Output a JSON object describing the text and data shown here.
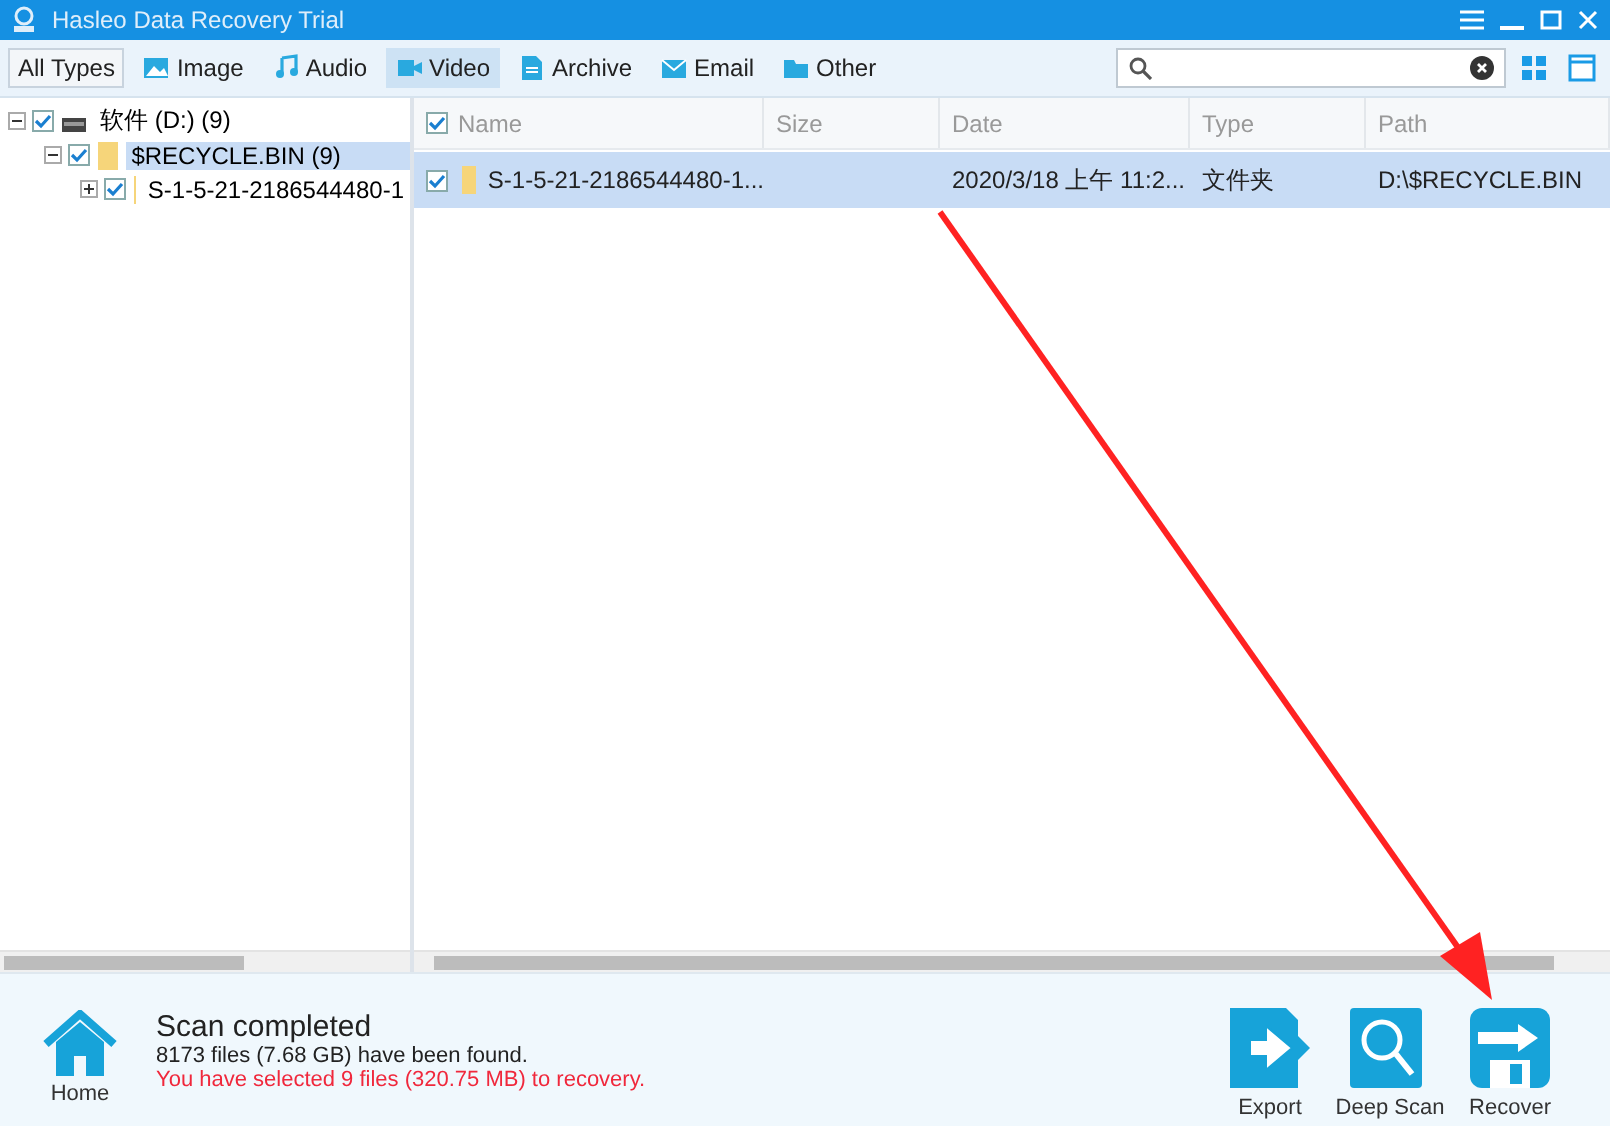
{
  "window": {
    "title": "Hasleo Data Recovery Trial"
  },
  "tabs": [
    {
      "label": "All Types",
      "kind": "all",
      "selected": false
    },
    {
      "label": "Image",
      "kind": "image",
      "selected": false
    },
    {
      "label": "Audio",
      "kind": "audio",
      "selected": false
    },
    {
      "label": "Video",
      "kind": "video",
      "selected": true
    },
    {
      "label": "Archive",
      "kind": "archive",
      "selected": false
    },
    {
      "label": "Email",
      "kind": "email",
      "selected": false
    },
    {
      "label": "Other",
      "kind": "other",
      "selected": false
    }
  ],
  "tree": [
    {
      "label": "软件 (D:) (9)",
      "kind": "drive",
      "expanded": true,
      "checked": true,
      "selected": false,
      "children": [
        {
          "label": "$RECYCLE.BIN (9)",
          "kind": "folder",
          "expanded": true,
          "checked": true,
          "selected": true,
          "children": [
            {
              "label": "S-1-5-21-2186544480-1",
              "kind": "folder",
              "expanded": false,
              "checked": true,
              "selected": false
            }
          ]
        }
      ]
    }
  ],
  "table": {
    "all_checked": true,
    "columns": [
      "Name",
      "Size",
      "Date",
      "Type",
      "Path"
    ],
    "rows": [
      {
        "checked": true,
        "selected": true,
        "cells": [
          "S-1-5-21-2186544480-1...",
          "",
          "2020/3/18 上午 11:2...",
          "文件夹",
          "D:\\$RECYCLE.BIN"
        ]
      }
    ]
  },
  "status": {
    "home_label": "Home",
    "title": "Scan completed",
    "found": "8173 files (7.68 GB) have been found.",
    "selected_info": "You have selected 9 files (320.75 MB) to recovery."
  },
  "actions": [
    {
      "label": "Export",
      "kind": "export"
    },
    {
      "label": "Deep Scan",
      "kind": "scan"
    },
    {
      "label": "Recover",
      "kind": "recover"
    }
  ]
}
